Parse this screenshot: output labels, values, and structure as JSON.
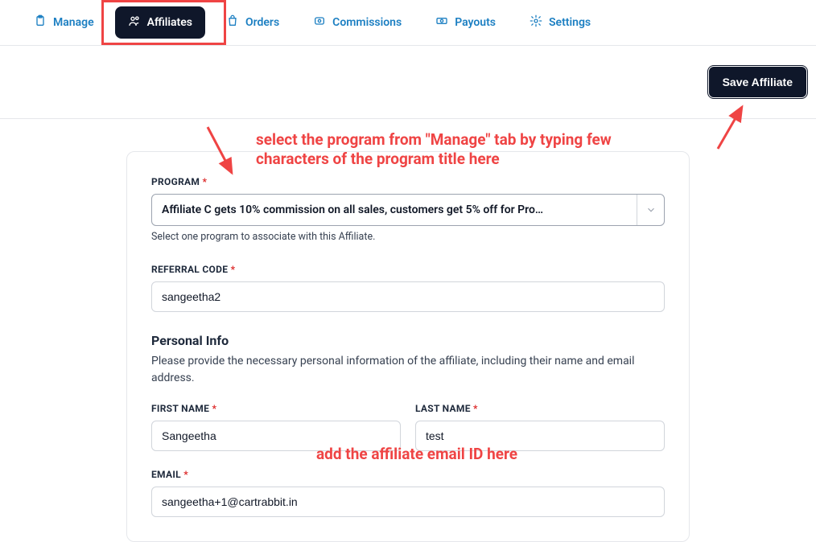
{
  "nav": {
    "items": [
      {
        "id": "manage",
        "label": "Manage",
        "icon": "clipboard-icon"
      },
      {
        "id": "affiliates",
        "label": "Affiliates",
        "icon": "users-icon",
        "active": true
      },
      {
        "id": "orders",
        "label": "Orders",
        "icon": "bag-icon"
      },
      {
        "id": "commissions",
        "label": "Commissions",
        "icon": "badge-icon"
      },
      {
        "id": "payouts",
        "label": "Payouts",
        "icon": "money-icon"
      },
      {
        "id": "settings",
        "label": "Settings",
        "icon": "gear-icon"
      }
    ]
  },
  "header": {
    "save_label": "Save Affiliate"
  },
  "form": {
    "program": {
      "label": "PROGRAM",
      "value": "Affiliate C gets 10% commission on all sales, customers get 5% off for Pro…",
      "helper": "Select one program to associate with this Affiliate."
    },
    "referral_code": {
      "label": "REFERRAL CODE",
      "value": "sangeetha2"
    },
    "personal": {
      "title": "Personal Info",
      "desc": "Please provide the necessary personal information of the affiliate, including their name and email address."
    },
    "first_name": {
      "label": "FIRST NAME",
      "value": "Sangeetha"
    },
    "last_name": {
      "label": "LAST NAME",
      "value": "test"
    },
    "email": {
      "label": "EMAIL",
      "value": "sangeetha+1@cartrabbit.in"
    }
  },
  "annotations": {
    "program_hint": "select the program from \"Manage\" tab by typing few characters of the program title here",
    "email_hint": "add the affiliate email ID here"
  },
  "colors": {
    "accent": "#1c7fc2",
    "dark": "#0f172a",
    "danger": "#ef4444"
  }
}
